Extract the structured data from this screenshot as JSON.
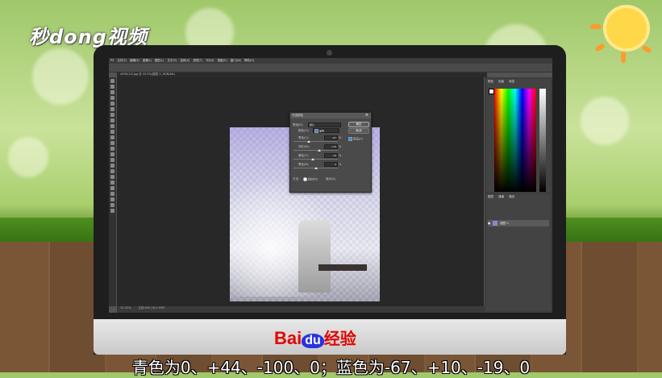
{
  "watermark": {
    "logo_text": "秒dong视频"
  },
  "photoshop": {
    "menu": [
      "PS",
      "文件(F)",
      "编辑(E)",
      "图像(I)",
      "图层(L)",
      "文字(Y)",
      "选择(S)",
      "滤镜(T)",
      "3D(D)",
      "视图(V)",
      "窗口(W)",
      "帮助(H)"
    ],
    "doc_tab": "4990/11f.jpg @ 33.5%(图层 0, RGB/8#)",
    "status_left": "33.33%",
    "status_doc": "文档:900.1K/1.60M",
    "right_panel_tabs": [
      "颜色",
      "色板",
      "渐变"
    ],
    "layers_tabs": [
      "图层",
      "通道",
      "路径"
    ],
    "layer_name": "图层 0",
    "dialog": {
      "title": "可选颜色",
      "preset_label": "预设(E):",
      "preset_value": "默认",
      "colors_label": "颜色(O):",
      "colors_value": "蓝色",
      "cyan_label": "青色(C):",
      "cyan_value": "-67",
      "magenta_label": "洋红(M):",
      "magenta_value": "+10",
      "yellow_label": "黄色(Y):",
      "yellow_value": "-19",
      "black_label": "黑色(B):",
      "black_value": "0",
      "percent": "%",
      "method_label": "方法:",
      "relative": "相对(R)",
      "absolute": "绝对(A)",
      "ok": "确定",
      "cancel": "取消",
      "preview": "预览(P)"
    }
  },
  "footer": {
    "brand": "Bai",
    "brand_du": "du",
    "brand_suffix": "经验",
    "caption": "青色为0、+44、-100、0；蓝色为-67、+10、-19、0"
  },
  "colors": {
    "baidu_red": "#e10601",
    "baidu_blue": "#2932e1",
    "ps_bg": "#282828"
  }
}
